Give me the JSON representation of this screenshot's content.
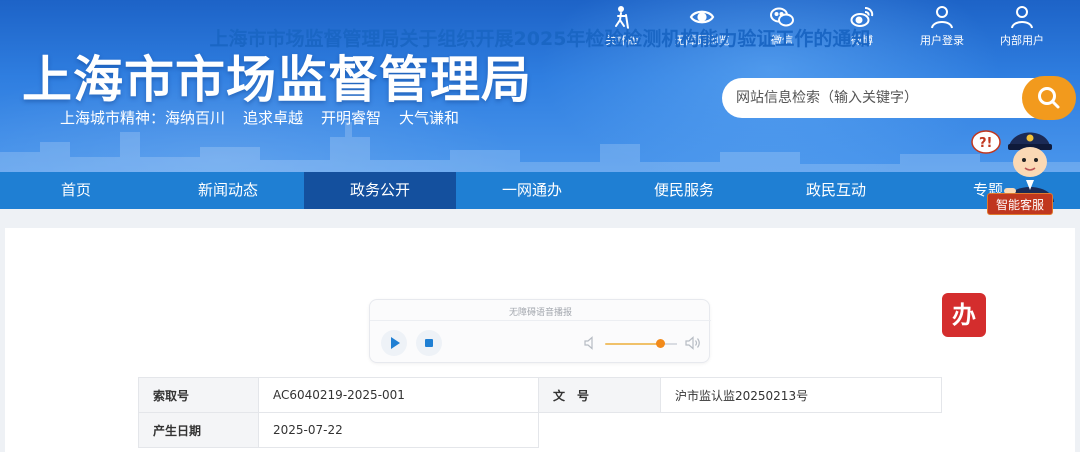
{
  "site": {
    "title": "上海市市场监督管理局",
    "slogan": [
      "上海城市精神：海纳百川",
      "追求卓越",
      "开明睿智",
      "大气谦和"
    ]
  },
  "tools": [
    {
      "label": "关怀版",
      "icon": "elderly-care-icon"
    },
    {
      "label": "无障碍浏览",
      "icon": "eye-icon"
    },
    {
      "label": "微信",
      "icon": "wechat-icon"
    },
    {
      "label": "微博",
      "icon": "weibo-icon"
    },
    {
      "label": "用户登录",
      "icon": "user-icon"
    },
    {
      "label": "内部用户",
      "icon": "user-icon"
    }
  ],
  "search": {
    "placeholder": "网站信息检索（输入关键字）",
    "icon": "search-icon"
  },
  "nav": {
    "active": "政务公开",
    "items": [
      "首页",
      "新闻动态",
      "政务公开",
      "一网通办",
      "便民服务",
      "政民互动",
      "专题"
    ]
  },
  "assistant": {
    "label": "智能客服"
  },
  "article": {
    "title": "上海市市场监督管理局关于组织开展2025年检验检测机构能力验证工作的通知",
    "ban_badge": "办"
  },
  "player": {
    "label": "无障碍语音播报",
    "volume": 0.78
  },
  "meta": {
    "index_label": "索取号",
    "index_value": "AC6040219-2025-001",
    "doc_label": "文　号",
    "doc_value": "沪市监认监20250213号",
    "date_label": "产生日期",
    "date_value": "2025-07-22"
  },
  "colors": {
    "header_blue": "#2f7ee0",
    "nav_blue": "#1f7fd3",
    "nav_active": "#14509e",
    "search_orange": "#f29a1d",
    "title_blue": "#1a66c4",
    "badge_red": "#d42d2d"
  }
}
